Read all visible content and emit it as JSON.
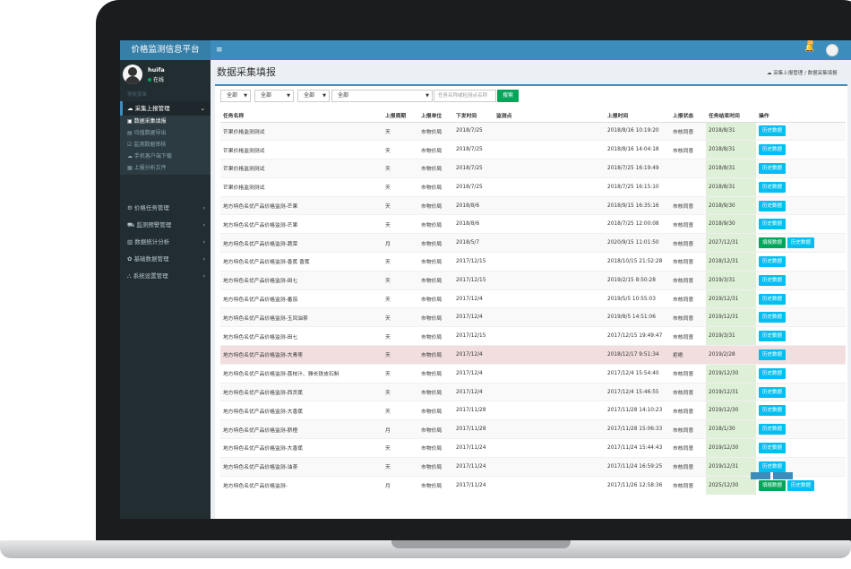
{
  "app": {
    "title": "价格监测信息平台",
    "menu_toggle": "≡",
    "notify_count": "26"
  },
  "user": {
    "name": "huifa",
    "status": "在线"
  },
  "sidebar": {
    "header": "导航菜单",
    "active_section": "采集上报管理",
    "sub_items": [
      {
        "label": "数据采集填报",
        "active": true
      },
      {
        "label": "均值数据导出"
      },
      {
        "label": "监测数据审核"
      },
      {
        "label": "手机客户端下载"
      },
      {
        "label": "上报分析文件"
      }
    ],
    "items": [
      {
        "label": "价格任务管理"
      },
      {
        "label": "监测预警管理"
      },
      {
        "label": "数据统计分析"
      },
      {
        "label": "基础数据管理"
      },
      {
        "label": "系统设置管理"
      }
    ]
  },
  "page": {
    "title": "数据采集填报",
    "breadcrumb": [
      "采集上报管理",
      "数据采集填报"
    ]
  },
  "filters": {
    "selects": [
      "全部",
      "全部",
      "全部",
      "全部"
    ],
    "search_placeholder": "任务名称或检测点名称",
    "search_label": "搜索"
  },
  "table": {
    "columns": [
      "任务名称",
      "上报周期",
      "上报单位",
      "下发时间",
      "监测点",
      "上报时间",
      "上报状态",
      "任务结束时间",
      "操作"
    ],
    "fill_label": "填报数据",
    "history_label": "历史数据",
    "rows": [
      {
        "name": "芒果价格监测测试",
        "cycle": "天",
        "unit": "市物价局",
        "issued": "2018/7/25",
        "point": "",
        "reported": "2018/8/16 10:19:20",
        "status": "市核同意",
        "end": "2018/8/31",
        "fill": false
      },
      {
        "name": "芒果价格监测测试",
        "cycle": "天",
        "unit": "市物价局",
        "issued": "2018/7/25",
        "point": "",
        "reported": "2018/8/16 14:04:18",
        "status": "市核同意",
        "end": "2018/8/31",
        "fill": false
      },
      {
        "name": "芒果价格监测测试",
        "cycle": "天",
        "unit": "市物价局",
        "issued": "2018/7/25",
        "point": "",
        "reported": "2018/7/25 16:19:49",
        "status": "",
        "end": "2018/8/31",
        "fill": false
      },
      {
        "name": "芒果价格监测测试",
        "cycle": "天",
        "unit": "市物价局",
        "issued": "2018/7/25",
        "point": "",
        "reported": "2018/7/25 16:15:10",
        "status": "",
        "end": "2018/8/31",
        "fill": false
      },
      {
        "name": "地方特色名优产品价格监测-芒果",
        "cycle": "天",
        "unit": "市物价局",
        "issued": "2018/8/6",
        "point": "",
        "reported": "2018/9/15 16:35:16",
        "status": "市核同意",
        "end": "2018/9/30",
        "fill": false
      },
      {
        "name": "地方特色名优产品价格监测-芒果",
        "cycle": "天",
        "unit": "市物价局",
        "issued": "2018/8/6",
        "point": "",
        "reported": "2018/7/25 12:00:08",
        "status": "市核同意",
        "end": "2018/9/30",
        "fill": false
      },
      {
        "name": "地方特色名优产品价格监测-蔬菜",
        "cycle": "月",
        "unit": "市物价局",
        "issued": "2018/5/7",
        "point": "",
        "reported": "2020/9/15 11:01:50",
        "status": "市核同意",
        "end": "2027/12/31",
        "fill": true
      },
      {
        "name": "地方特色名优产品价格监测-香蕉 香蕉",
        "cycle": "天",
        "unit": "市物价局",
        "issued": "2017/12/15",
        "point": "",
        "reported": "2018/10/15 21:52:28",
        "status": "市核同意",
        "end": "2018/12/31",
        "fill": false
      },
      {
        "name": "地方特色名优产品价格监测-田七",
        "cycle": "天",
        "unit": "市物价局",
        "issued": "2017/12/15",
        "point": "",
        "reported": "2019/2/15 8:50:28",
        "status": "市核同意",
        "end": "2019/3/31",
        "fill": false
      },
      {
        "name": "地方特色名优产品价格监测-番茄",
        "cycle": "天",
        "unit": "市物价局",
        "issued": "2017/12/4",
        "point": "",
        "reported": "2019/5/5 10:55:03",
        "status": "市核同意",
        "end": "2019/12/31",
        "fill": false
      },
      {
        "name": "地方特色名优产品价格监测-玉凤油茶",
        "cycle": "天",
        "unit": "市物价局",
        "issued": "2017/12/4",
        "point": "",
        "reported": "2019/8/5 14:51:06",
        "status": "市核同意",
        "end": "2019/12/31",
        "fill": false
      },
      {
        "name": "地方特色名优产品价格监测-田七",
        "cycle": "天",
        "unit": "市物价局",
        "issued": "2017/12/15",
        "point": "",
        "reported": "2017/12/15 19:49:47",
        "status": "市核同意",
        "end": "2019/3/31",
        "fill": false
      },
      {
        "name": "地方特色名优产品价格监测-大青枣",
        "cycle": "天",
        "unit": "市物价局",
        "issued": "2017/12/4",
        "point": "",
        "reported": "2018/12/17 9:51:34",
        "status": "拒绝",
        "end": "2019/2/28",
        "fill": false,
        "danger": true
      },
      {
        "name": "地方特色名优产品价格监测-荔枝汁、雅长铁皮石斛",
        "cycle": "天",
        "unit": "市物价局",
        "issued": "2017/12/4",
        "point": "",
        "reported": "2017/12/4 15:54:40",
        "status": "市核同意",
        "end": "2019/12/30",
        "fill": false
      },
      {
        "name": "地方特色名优产品价格监测-西贡蕉",
        "cycle": "天",
        "unit": "市物价局",
        "issued": "2017/12/4",
        "point": "",
        "reported": "2017/12/4 15:46:55",
        "status": "市核同意",
        "end": "2019/12/31",
        "fill": false
      },
      {
        "name": "地方特色名优产品价格监测-大香蕉",
        "cycle": "天",
        "unit": "市物价局",
        "issued": "2017/11/28",
        "point": "",
        "reported": "2017/11/28 14:10:23",
        "status": "市核同意",
        "end": "2019/12/30",
        "fill": false
      },
      {
        "name": "地方特色名优产品价格监测-脐橙",
        "cycle": "月",
        "unit": "市物价局",
        "issued": "2017/11/28",
        "point": "",
        "reported": "2017/11/28 15:06:33",
        "status": "市核同意",
        "end": "2018/1/30",
        "fill": false
      },
      {
        "name": "地方特色名优产品价格监测-大香蕉",
        "cycle": "天",
        "unit": "市物价局",
        "issued": "2017/11/24",
        "point": "",
        "reported": "2017/11/24 15:44:43",
        "status": "市核同意",
        "end": "2019/12/30",
        "fill": false
      },
      {
        "name": "地方特色名优产品价格监测-油茶",
        "cycle": "天",
        "unit": "市物价局",
        "issued": "2017/11/24",
        "point": "",
        "reported": "2017/11/24 16:59:25",
        "status": "市核同意",
        "end": "2019/12/31",
        "fill": false
      },
      {
        "name": "地方特色名优产品价格监测-",
        "cycle": "月",
        "unit": "市物价局",
        "issued": "2017/11/24",
        "point": "",
        "reported": "2017/11/26 12:58:36",
        "status": "市核同意",
        "end": "2025/12/30",
        "fill": true
      }
    ]
  }
}
